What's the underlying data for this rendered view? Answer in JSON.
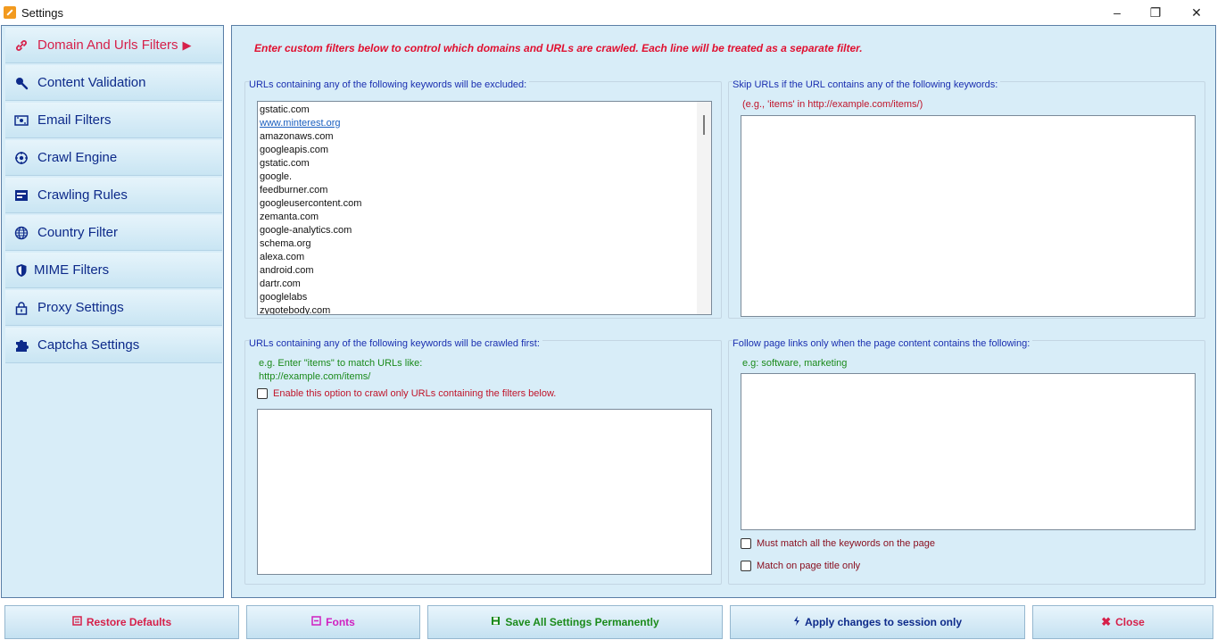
{
  "window": {
    "title": "Settings",
    "minimize": "–",
    "maximize": "❐",
    "close": "✕"
  },
  "sidebar": {
    "items": [
      {
        "label": "Domain And Urls Filters",
        "icon": "link-icon",
        "active": true
      },
      {
        "label": "Content Validation",
        "icon": "magnifier-icon"
      },
      {
        "label": "Email Filters",
        "icon": "mail-icon"
      },
      {
        "label": "Crawl Engine",
        "icon": "engine-icon"
      },
      {
        "label": "Crawling Rules",
        "icon": "rules-icon"
      },
      {
        "label": "Country Filter",
        "icon": "globe-icon"
      },
      {
        "label": "MIME Filters",
        "icon": "shield-icon"
      },
      {
        "label": "Proxy Settings",
        "icon": "lock-icon"
      },
      {
        "label": "Captcha Settings",
        "icon": "puzzle-icon"
      }
    ],
    "active_arrow": "▶"
  },
  "main": {
    "intro": "Enter custom filters below to control which domains and URLs are crawled. Each line will be treated as a separate filter.",
    "excluded": {
      "title": "URLs containing any of the following keywords will be excluded:",
      "lines": [
        "gstatic.com",
        "www.minterest.org",
        "amazonaws.com",
        "googleapis.com",
        "gstatic.com",
        "google.",
        "feedburner.com",
        "googleusercontent.com",
        "zemanta.com",
        "google-analytics.com",
        "schema.org",
        "alexa.com",
        "android.com",
        "dartr.com",
        "googlelabs",
        "zygotebody.com"
      ]
    },
    "skip": {
      "title": "Skip URLs if the URL contains any of the following keywords:",
      "hint": "(e.g., 'items' in http://example.com/items/)"
    },
    "first": {
      "title": "URLs containing any of the following keywords will be crawled first:",
      "hint1": "e.g. Enter \"items\" to match URLs like:",
      "hint2": "http://example.com/items/",
      "option": "Enable this option to crawl only URLs containing the filters below."
    },
    "follow": {
      "title": "Follow page links only when the page content contains the following:",
      "hint": "e.g: software, marketing",
      "option1": "Must match all the keywords on the page",
      "option2": "Match on page title only"
    }
  },
  "buttons": {
    "restore": "Restore Defaults",
    "fonts": "Fonts",
    "save": "Save All Settings Permanently",
    "apply": "Apply changes to session only",
    "close": "Close"
  },
  "colors": {
    "accent_red": "#d6204a",
    "nav_text": "#0d2a8a",
    "panel_bg": "#d8edf8",
    "save_green": "#1a8a1a",
    "fonts_pink": "#d020c0"
  }
}
